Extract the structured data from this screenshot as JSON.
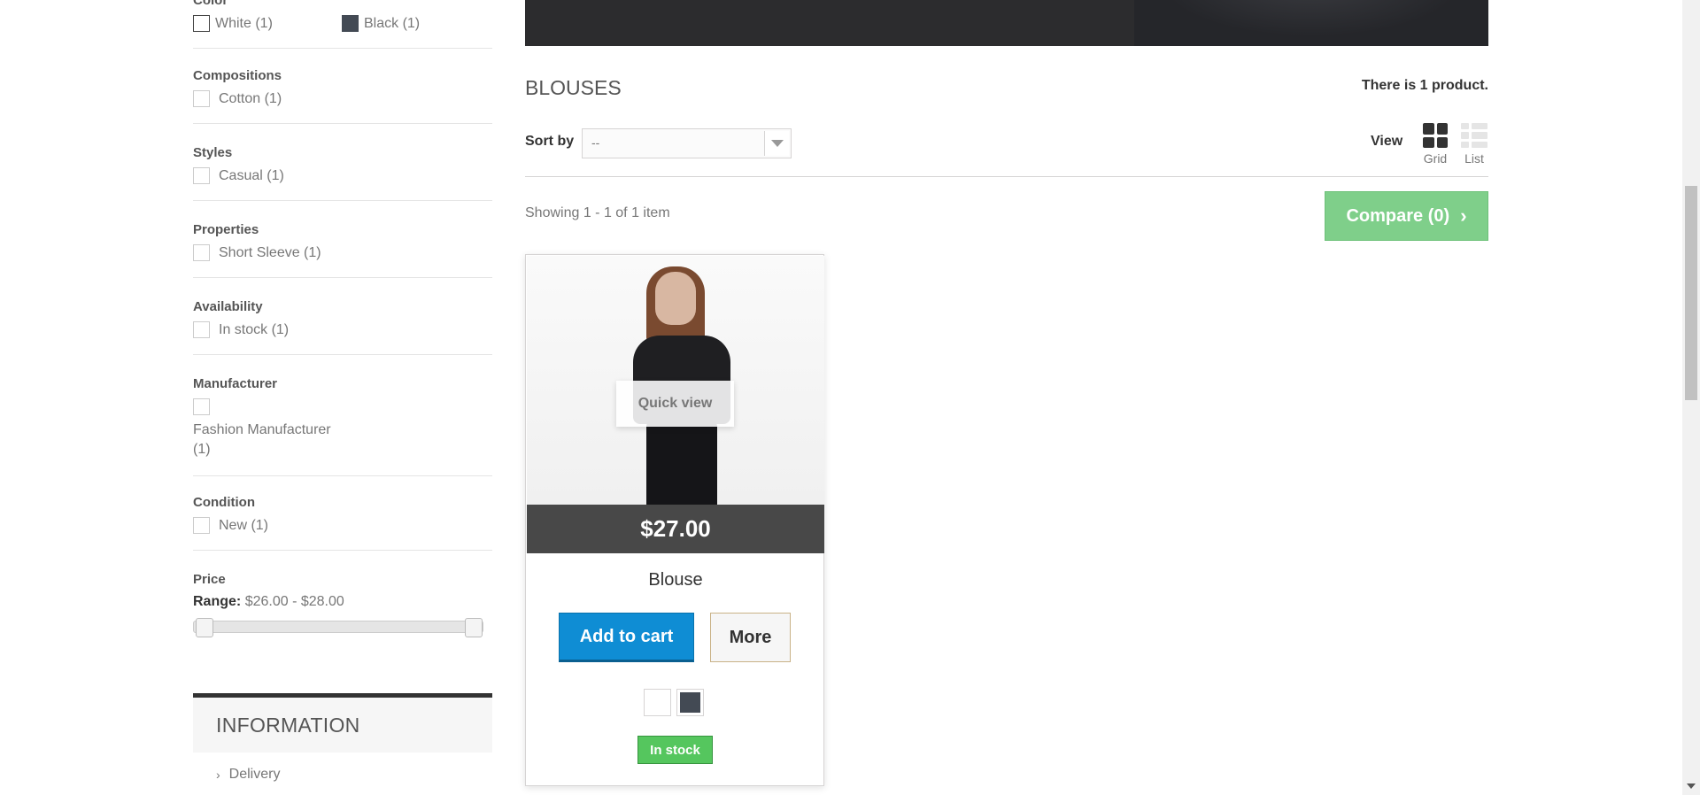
{
  "filters": {
    "color": {
      "title": "Color",
      "items": [
        {
          "label": "White (1)",
          "swatch": "#ffffff"
        },
        {
          "label": "Black (1)",
          "swatch": "#434a54"
        }
      ]
    },
    "compositions": {
      "title": "Compositions",
      "items": [
        {
          "label": "Cotton (1)"
        }
      ]
    },
    "styles": {
      "title": "Styles",
      "items": [
        {
          "label": "Casual (1)"
        }
      ]
    },
    "properties": {
      "title": "Properties",
      "items": [
        {
          "label": "Short Sleeve (1)"
        }
      ]
    },
    "availability": {
      "title": "Availability",
      "items": [
        {
          "label": "In stock (1)"
        }
      ]
    },
    "manufacturer": {
      "title": "Manufacturer",
      "items": [
        {
          "label": "Fashion Manufacturer (1)"
        }
      ]
    },
    "condition": {
      "title": "Condition",
      "items": [
        {
          "label": "New (1)"
        }
      ]
    },
    "price": {
      "title": "Price",
      "range_label": "Range:",
      "range_value": "$26.00 - $28.00"
    }
  },
  "information": {
    "title": "INFORMATION",
    "links": [
      {
        "label": "Delivery"
      }
    ]
  },
  "category": {
    "title": "BLOUSES",
    "product_count": "There is 1 product.",
    "sort_label": "Sort by",
    "sort_value": "--",
    "view_label": "View",
    "view_grid": "Grid",
    "view_list": "List",
    "showing": "Showing 1 - 1 of 1 item",
    "compare_label": "Compare (0)"
  },
  "product": {
    "quick_view": "Quick view",
    "price": "$27.00",
    "name": "Blouse",
    "add_to_cart": "Add to cart",
    "more": "More",
    "colors": [
      "#ffffff",
      "#434a54"
    ],
    "stock": "In stock"
  }
}
